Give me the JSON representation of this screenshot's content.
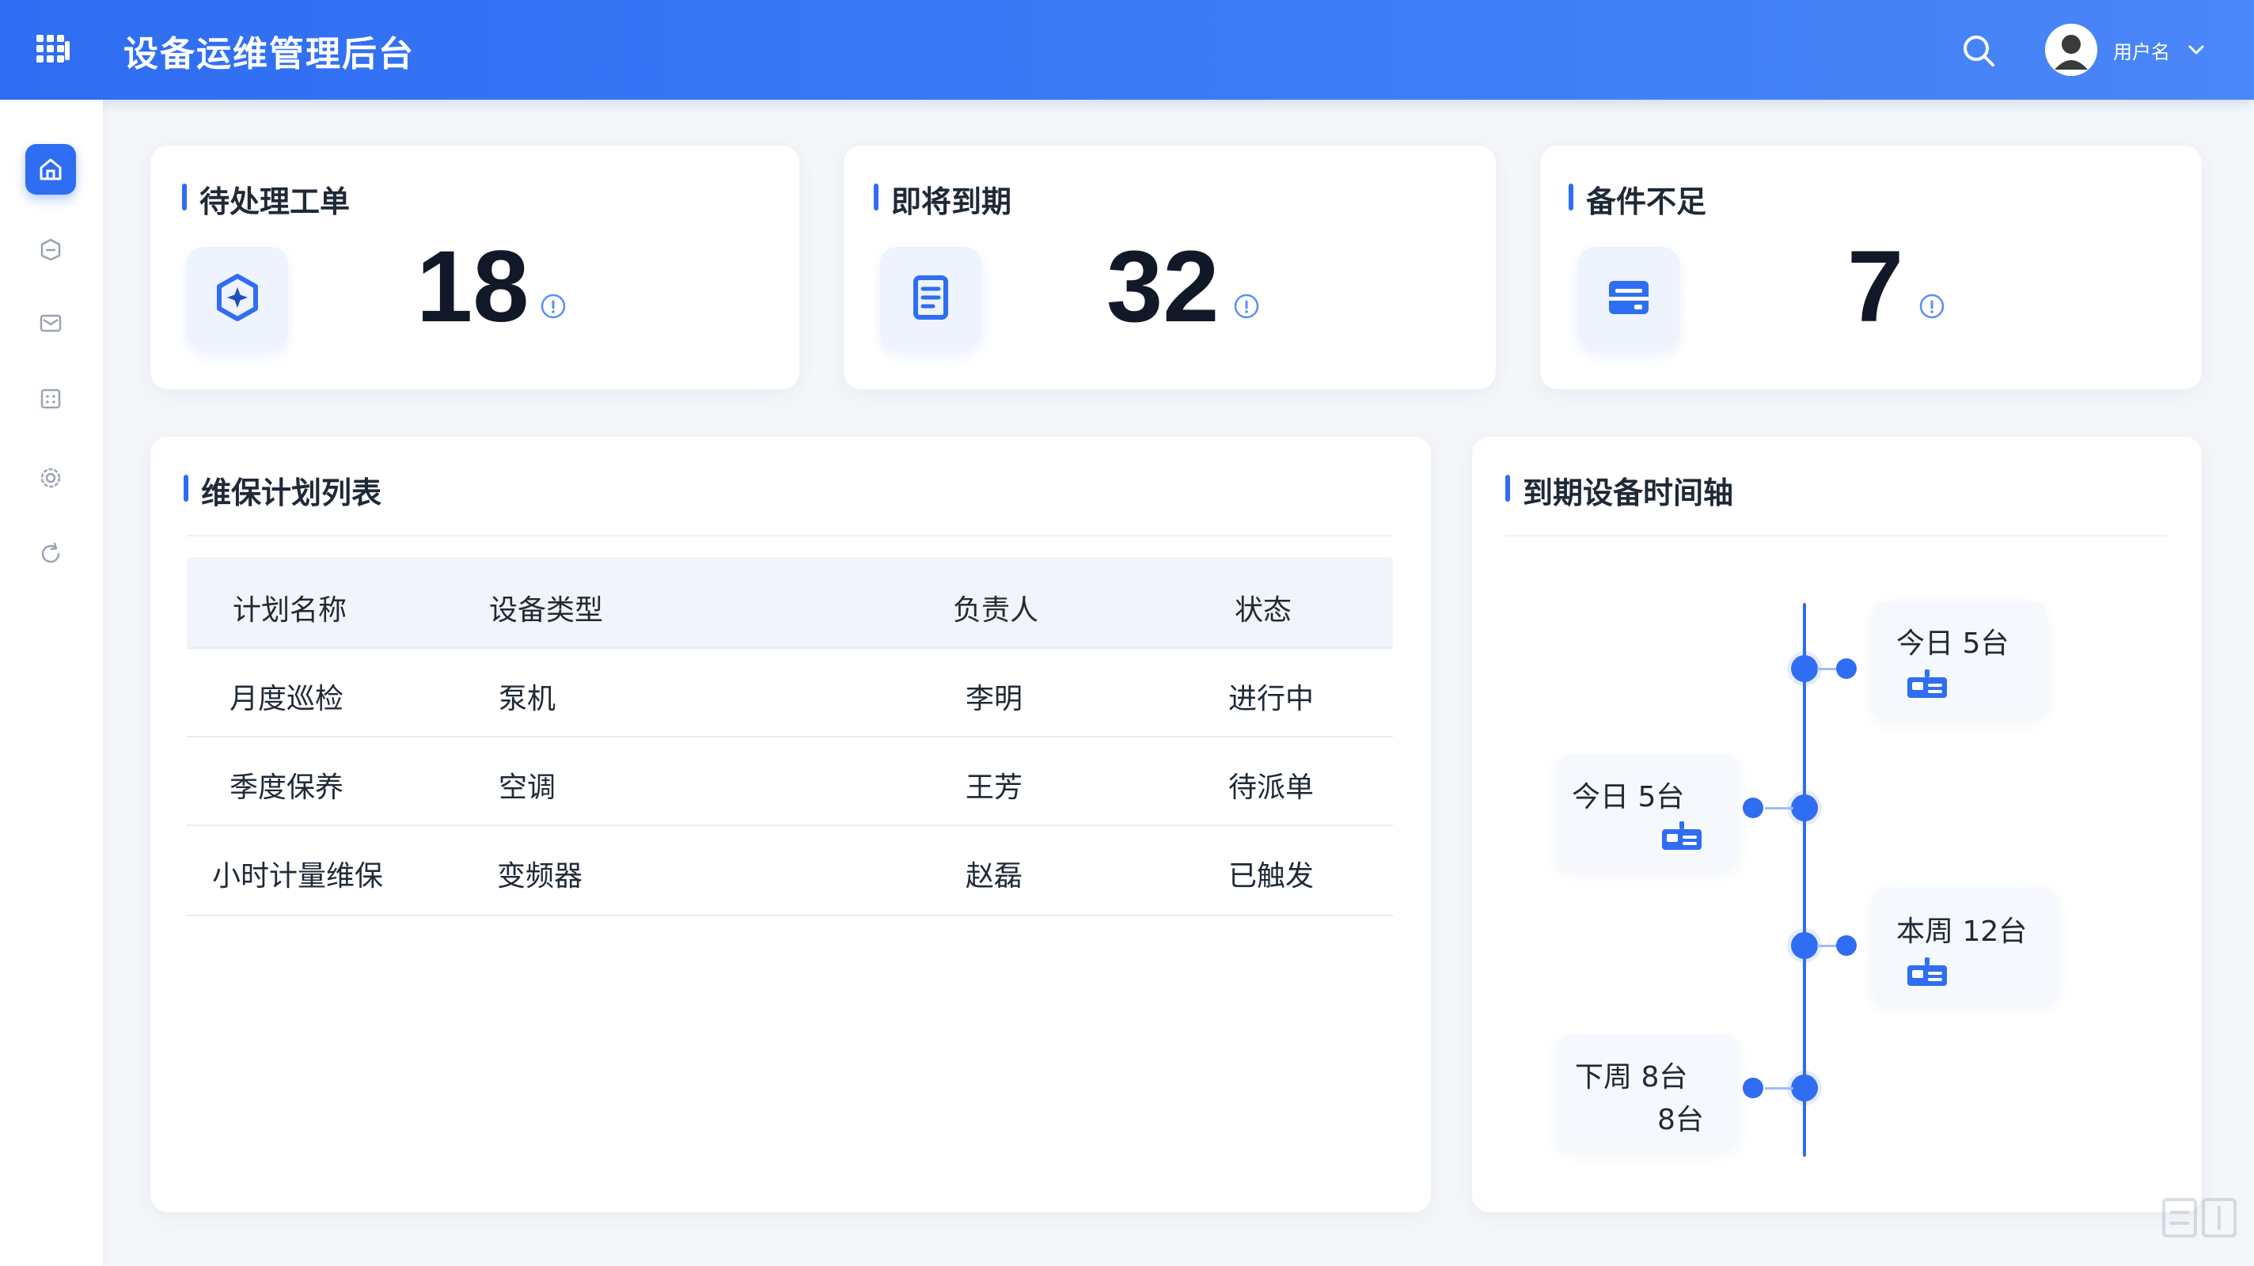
{
  "header": {
    "title": "设备运维管理后台",
    "user_name": "用户名"
  },
  "sidebar": {
    "items": [
      {
        "icon": "home-icon"
      },
      {
        "icon": "box-icon"
      },
      {
        "icon": "mail-icon"
      },
      {
        "icon": "scan-icon"
      },
      {
        "icon": "settings-icon"
      },
      {
        "icon": "refresh-icon"
      }
    ]
  },
  "stats": [
    {
      "title": "待处理工单",
      "value": "18",
      "icon": "hexagon-star-icon"
    },
    {
      "title": "即将到期",
      "value": "32",
      "icon": "document-icon"
    },
    {
      "title": "备件不足",
      "value": "7",
      "icon": "card-icon"
    }
  ],
  "plans": {
    "title": "维保计划列表",
    "columns": [
      "计划名称",
      "设备类型",
      "负责人",
      "状态"
    ],
    "rows": [
      [
        "月度巡检",
        "泵机",
        "李明",
        "进行中"
      ],
      [
        "季度保养",
        "空调",
        "王芳",
        "待派单"
      ],
      [
        "小时计量维保",
        "变频器",
        "赵磊",
        "已触发"
      ]
    ]
  },
  "timeline": {
    "title": "到期设备时间轴",
    "entries": [
      {
        "label": "今日 5台",
        "side": "right"
      },
      {
        "label": "今日 5台",
        "side": "left"
      },
      {
        "label": "本周 12台",
        "side": "right"
      },
      {
        "label": "下周 8台",
        "extra": "8台",
        "side": "left"
      }
    ]
  },
  "colors": {
    "brand": "#2f6df2",
    "header_gradient_end": "#4a86f7",
    "card_bg": "#ffffff",
    "page_bg": "#f4f6f9"
  }
}
